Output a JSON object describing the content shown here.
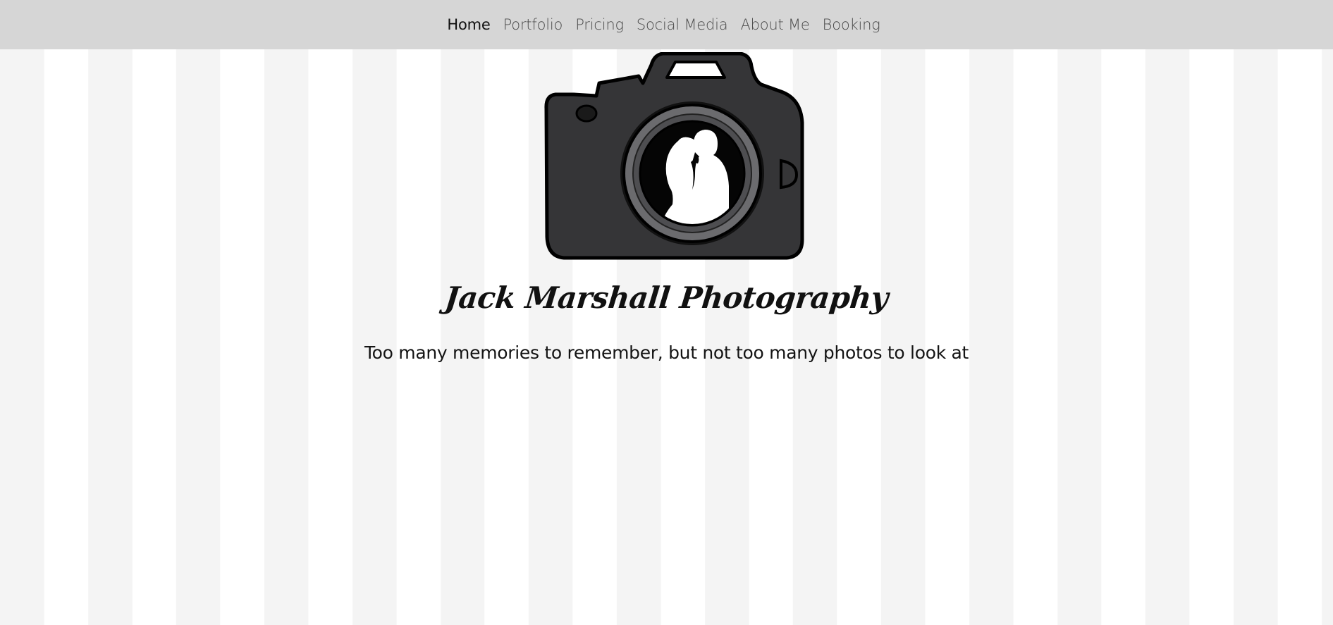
{
  "nav": {
    "items": [
      {
        "label": "Home",
        "active": true
      },
      {
        "label": "Portfolio",
        "active": false
      },
      {
        "label": "Pricing",
        "active": false
      },
      {
        "label": "Social Media",
        "active": false
      },
      {
        "label": "About Me",
        "active": false
      },
      {
        "label": "Booking",
        "active": false
      }
    ]
  },
  "hero": {
    "logo_icon": "camera-couple-logo-icon",
    "title": "Jack Marshall Photography",
    "tagline": "Too many memories to remember, but not too many photos to look at"
  },
  "colors": {
    "navbar_bg": "#d6d6d6",
    "stripe_light": "#ffffff",
    "stripe_gray": "#f4f4f4",
    "camera_body": "#353537",
    "lens_ring": "#6b6b6e",
    "text": "#111111"
  }
}
